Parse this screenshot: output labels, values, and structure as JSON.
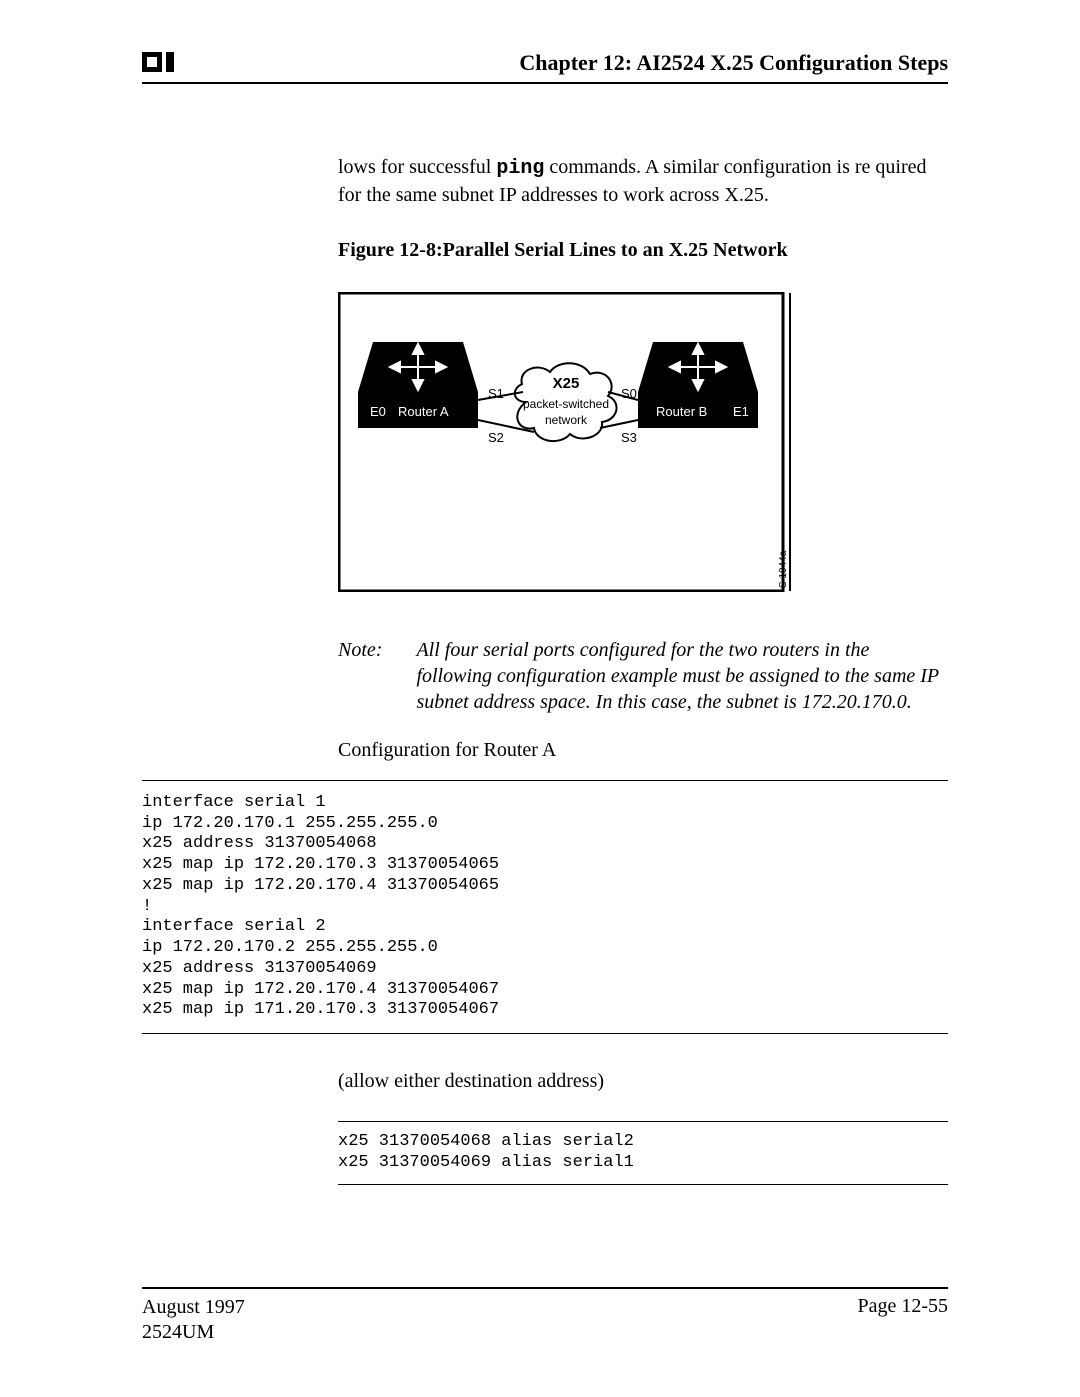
{
  "header": {
    "chapter_title": "Chapter 12: AI2524 X.25 Configuration Steps"
  },
  "body": {
    "para_prefix": "lows for successful ",
    "para_cmd": "ping",
    "para_suffix": " commands. A similar configuration is re quired for the same subnet IP addresses to work across X.25.",
    "figure_title": "Figure 12-8:Parallel Serial Lines to an X.25 Network",
    "note_label": "Note:",
    "note_text": "All four serial ports configured for the two routers in the following configuration example must be assigned to the same IP subnet address space. In this case, the subnet is 172.20.170.0.",
    "config_label": "Configuration for Router A",
    "allow_text": "(allow either destination address)"
  },
  "figure": {
    "router_a": "Router A",
    "router_b": "Router B",
    "e0": "E0",
    "e1": "E1",
    "s0": "S0",
    "s1": "S1",
    "s2": "S2",
    "s3": "S3",
    "cloud_top": "X25",
    "cloud_mid": "packet-switched",
    "cloud_bot": "network",
    "side_label": "S 1044a"
  },
  "code": {
    "block1": "interface serial 1\nip 172.20.170.1 255.255.255.0\nx25 address 31370054068\nx25 map ip 172.20.170.3 31370054065\nx25 map ip 172.20.170.4 31370054065\n!\ninterface serial 2\nip 172.20.170.2 255.255.255.0\nx25 address 31370054069\nx25 map ip 172.20.170.4 31370054067\nx25 map ip 171.20.170.3 31370054067",
    "block2": "x25 31370054068 alias serial2\nx25 31370054069 alias serial1"
  },
  "footer": {
    "date": "August 1997",
    "docid": "2524UM",
    "page": "Page 12-55"
  }
}
